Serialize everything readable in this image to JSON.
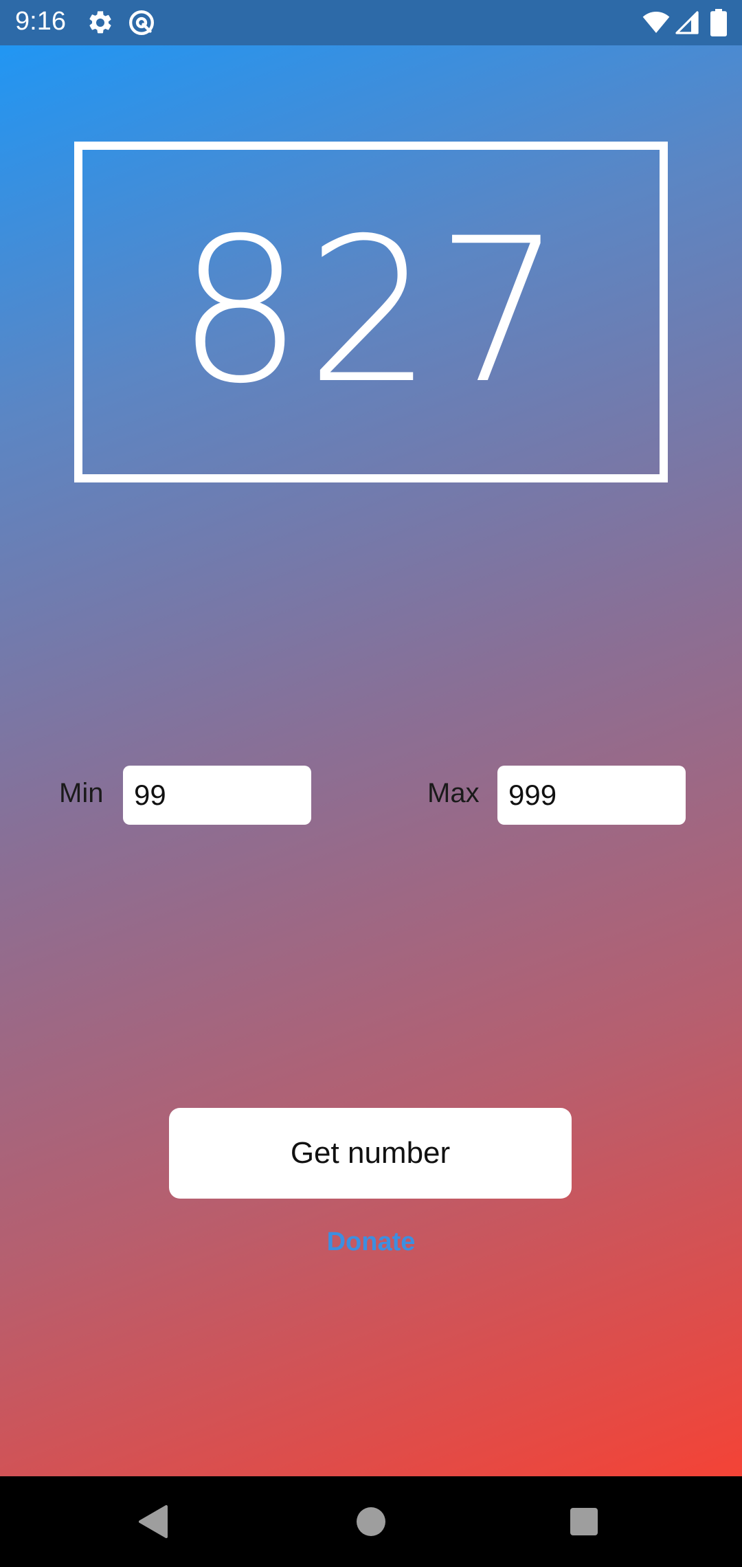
{
  "status_bar": {
    "time": "9:16",
    "left_icons": [
      "gear-icon",
      "at-sign-icon"
    ],
    "right_icons": [
      "wifi-icon",
      "signal-icon",
      "battery-icon"
    ],
    "background_color": "#2d6aa8"
  },
  "app": {
    "result_number": "827",
    "min": {
      "label": "Min",
      "value": "99"
    },
    "max": {
      "label": "Max",
      "value": "999"
    },
    "get_button_label": "Get number",
    "donate_label": "Donate",
    "gradient_colors": [
      "#2196f3",
      "#f44336"
    ],
    "donate_color": "#3d8fe0"
  },
  "nav_bar": {
    "buttons": [
      "back-icon",
      "home-icon",
      "recents-icon"
    ]
  }
}
